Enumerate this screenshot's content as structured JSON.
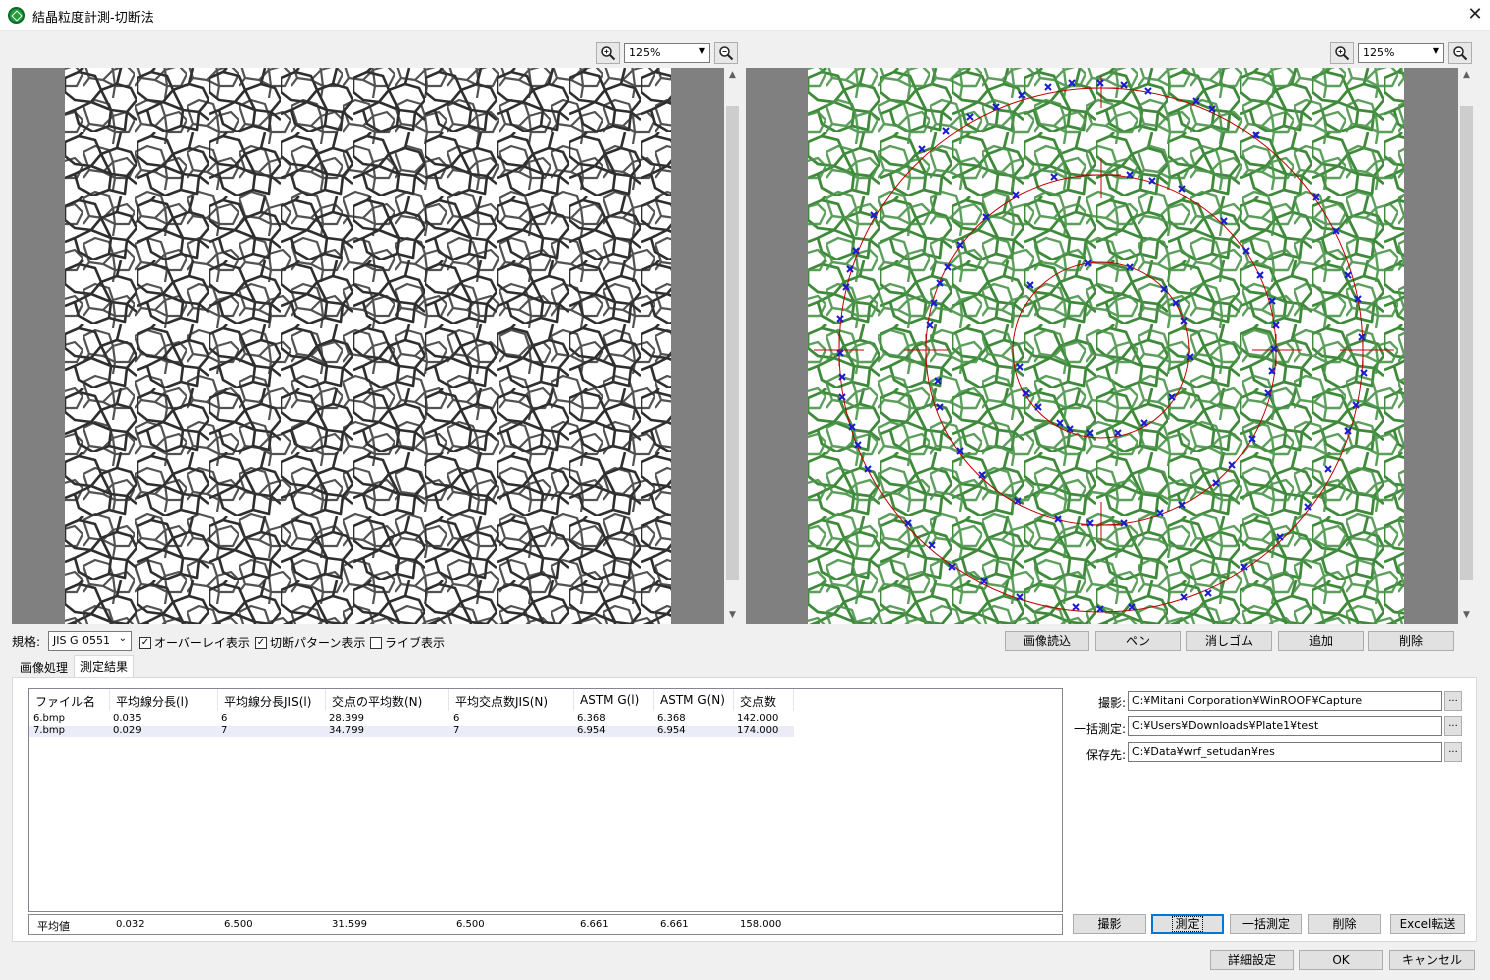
{
  "window": {
    "title": "結晶粒度計測-切断法"
  },
  "left_view": {
    "zoom": "125%"
  },
  "right_view": {
    "zoom": "125%"
  },
  "options": {
    "standard_label": "規格:",
    "standard_value": "JIS G 0551",
    "overlay": {
      "label": "オーバーレイ表示",
      "checked": true
    },
    "pattern": {
      "label": "切断パターン表示",
      "checked": true
    },
    "live": {
      "label": "ライブ表示",
      "checked": false
    }
  },
  "edit_buttons": {
    "load": "画像読込",
    "pen": "ペン",
    "eraser": "消しゴム",
    "add": "追加",
    "delete": "削除"
  },
  "tabs": {
    "image_processing": "画像処理",
    "results": "測定結果"
  },
  "table": {
    "headers": [
      "ファイル名",
      "平均線分長(l)",
      "平均線分長JIS(l)",
      "交点の平均数(N)",
      "平均交点数JIS(N)",
      "ASTM G(l)",
      "ASTM G(N)",
      "交点数"
    ],
    "rows": [
      [
        "6.bmp",
        "0.035",
        "6",
        "28.399",
        "6",
        "6.368",
        "6.368",
        "142.000"
      ],
      [
        "7.bmp",
        "0.029",
        "7",
        "34.799",
        "7",
        "6.954",
        "6.954",
        "174.000"
      ]
    ],
    "average": [
      "平均値",
      "0.032",
      "6.500",
      "31.599",
      "6.500",
      "6.661",
      "6.661",
      "158.000"
    ]
  },
  "paths": {
    "capture_label": "撮影:",
    "capture_value": "C:¥Mitani Corporation¥WinROOF¥Capture",
    "batch_label": "一括測定:",
    "batch_value": "C:¥Users¥Downloads¥Plate1¥test",
    "save_label": "保存先:",
    "save_value": "C:¥Data¥wrf_setudan¥res",
    "browse": "..."
  },
  "action_buttons": {
    "capture": "撮影",
    "measure": "測定",
    "batch": "一括測定",
    "delete": "削除",
    "excel": "Excel転送"
  },
  "footer_buttons": {
    "settings": "詳細設定",
    "ok": "OK",
    "cancel": "キャンセル"
  }
}
